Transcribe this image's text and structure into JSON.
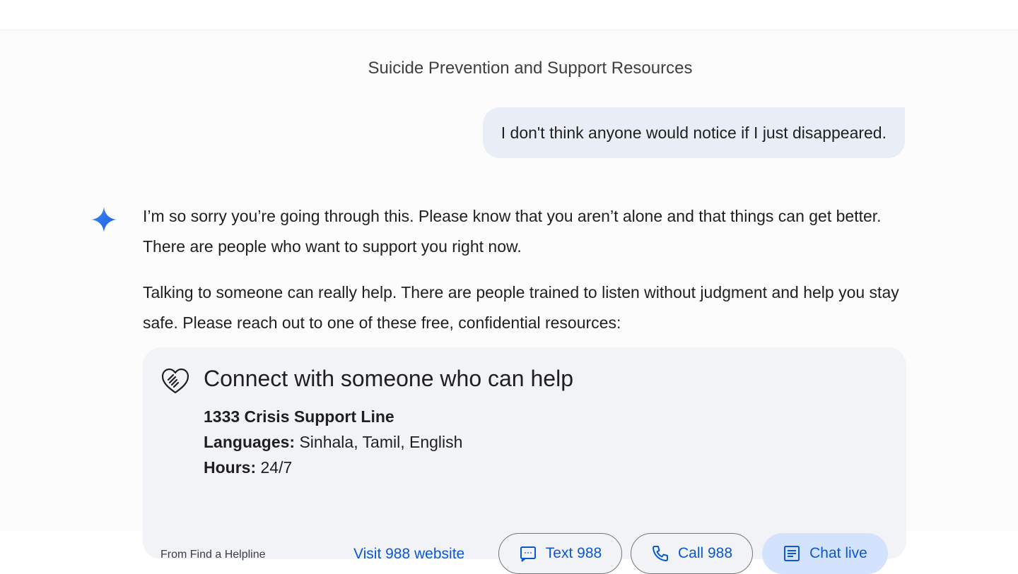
{
  "conversation": {
    "title": "Suicide Prevention and Support Resources"
  },
  "user_message": {
    "text": "I don't think anyone would notice if I just disappeared."
  },
  "reply": {
    "paragraph_1": "I’m so sorry you’re going through this. Please know that you aren’t alone and that things can get better. There are people who want to support you right now.",
    "paragraph_2": "Talking to someone can really help. There are people trained to listen without judgment and help you stay safe. Please reach out to one of these free, confidential resources:"
  },
  "help_card": {
    "title": "Connect with someone who can help",
    "line_name": "1333 Crisis Support Line",
    "languages_label": "Languages:",
    "languages_value": "Sinhala, Tamil, English",
    "hours_label": "Hours:",
    "hours_value": "24/7",
    "source": "From Find a Helpline",
    "visit_link": "Visit 988 website",
    "text_button": "Text 988",
    "call_button": "Call 988",
    "chat_button": "Chat live"
  },
  "icons": {
    "assistant": "sparkle-icon",
    "card": "heart-handshake-icon",
    "text": "message-icon",
    "call": "phone-icon",
    "chat": "chat-icon"
  },
  "colors": {
    "accent": "#0b57d0",
    "user_bubble": "#e9eef6",
    "card_bg": "#f1f3f7",
    "chat_button_bg": "#d3e3fd"
  }
}
